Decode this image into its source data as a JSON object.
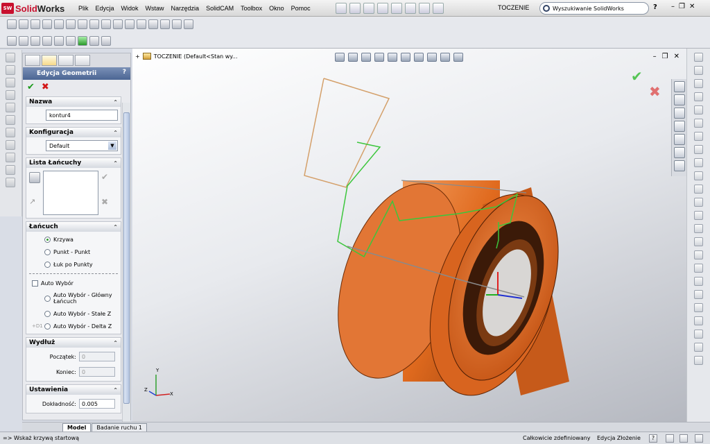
{
  "app": {
    "logo_ds": "SW",
    "logo_prefix": "Solid",
    "logo_suffix": "Works",
    "menu": [
      "Plik",
      "Edycja",
      "Widok",
      "Wstaw",
      "Narzędzia",
      "SolidCAM",
      "Toolbox",
      "Okno",
      "Pomoc"
    ],
    "document_title": "TOCZENIE",
    "search_placeholder": "Wyszukiwanie SolidWorks",
    "help_label": "?"
  },
  "panel": {
    "title": "Edycja Geometrii",
    "help": "?",
    "ok": "✔",
    "cancel": "✖",
    "groups": {
      "nazwa": {
        "title": "Nazwa",
        "value": "kontur4"
      },
      "konfiguracja": {
        "title": "Konfiguracja",
        "value": "Default"
      },
      "lista": {
        "title": "Lista Łańcuchy"
      },
      "lancuch": {
        "title": "Łańcuch",
        "options": [
          "Krzywa",
          "Punkt - Punkt",
          "Łuk po Punkty"
        ],
        "auto_label": "Auto Wybór",
        "auto_options": [
          "Auto Wybór - Główny Łańcuch",
          "Auto Wybór - Stałe Z",
          "Auto Wybór - Delta Z"
        ],
        "delta_prefix": "+D1"
      },
      "wydluz": {
        "title": "Wydłuż",
        "start_label": "Początek:",
        "start_value": "0",
        "end_label": "Koniec:",
        "end_value": "0"
      },
      "ustawienia": {
        "title": "Ustawienia",
        "precision_label": "Dokładność:",
        "precision_value": "0.005"
      }
    }
  },
  "viewport": {
    "tree_label": "TOCZENIE  (Default<Stan wy...",
    "confirm_ok": "✔",
    "confirm_cancel": "✖",
    "triad": {
      "x": "X",
      "y": "Y",
      "z": "Z"
    }
  },
  "bottom_tabs": [
    "Model",
    "Badanie ruchu 1"
  ],
  "status": {
    "prompt": "=> Wskaż krzywą startową",
    "definition": "Całkowicie zdefiniowany",
    "mode": "Edycja Złożenie",
    "help": "?"
  },
  "colors": {
    "part": "#e06a1e",
    "chain_green": "#3cc63c",
    "sketch_orange": "#d4a06a",
    "panel_header": "#5a72a2"
  }
}
